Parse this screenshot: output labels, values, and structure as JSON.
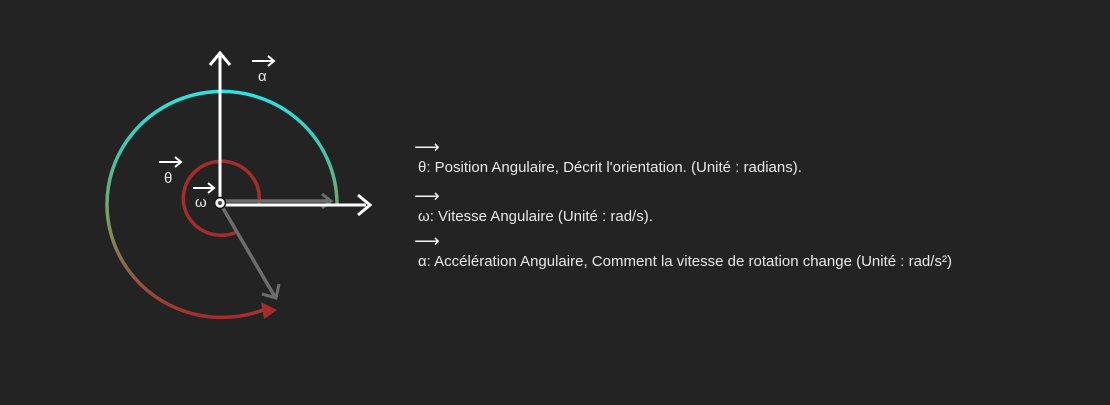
{
  "symbols": {
    "alpha": "α",
    "theta": "θ",
    "omega": "ω",
    "arrow": "⟶"
  },
  "legend": [
    {
      "symbol": "θ",
      "text": ": Position Angulaire, Décrit l'orientation. (Unité : radians)."
    },
    {
      "symbol": "ω",
      "text": ": Vitesse Angulaire (Unité : rad/s)."
    },
    {
      "symbol": "α",
      "text": ": Accélération Angulaire, Comment la vitesse de rotation change (Unité : rad/s²)"
    }
  ],
  "colors": {
    "background": "#232323",
    "axes": "#ffffff",
    "arc_start": "#a32d2d",
    "arc_mid": "#3fc7b0",
    "arc_end": "#2ee3e3",
    "small_arc": "#a32d2d",
    "gray_vector": "#6d6d6d",
    "text": "#e8e8e8"
  }
}
